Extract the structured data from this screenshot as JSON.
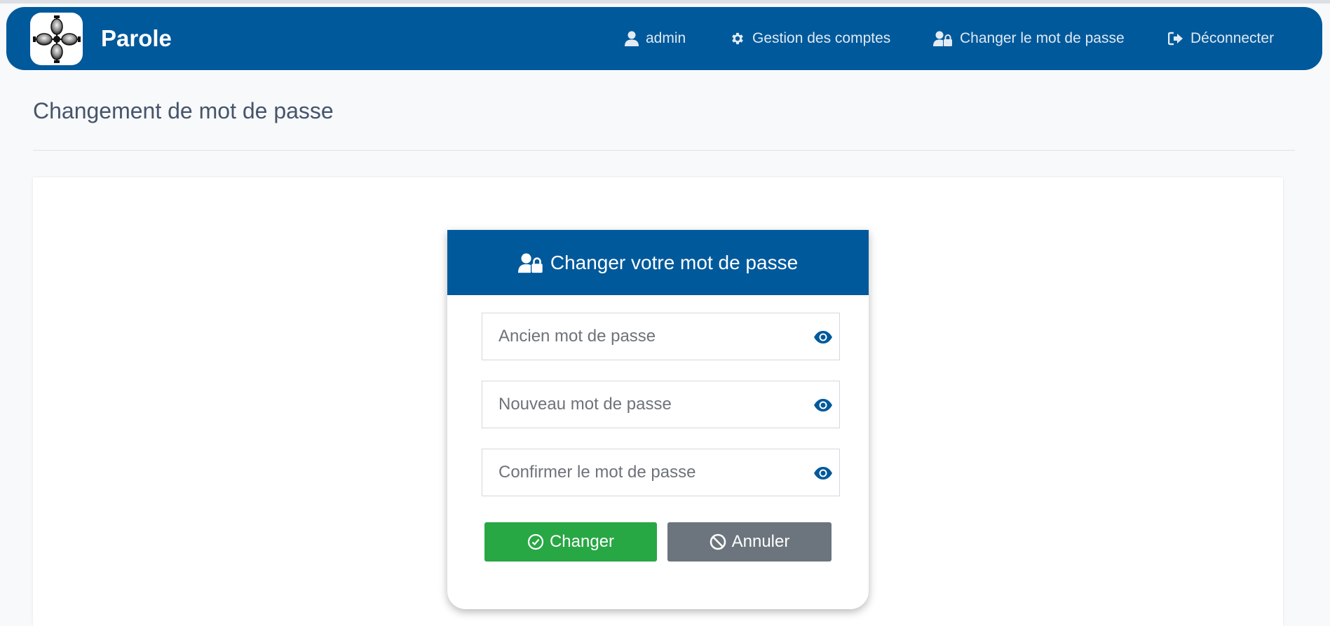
{
  "navbar": {
    "brand": "Parole",
    "items": [
      {
        "label": "admin",
        "icon": "user-icon"
      },
      {
        "label": "Gestion des comptes",
        "icon": "gear-icon"
      },
      {
        "label": "Changer le mot de passe",
        "icon": "user-lock-icon"
      },
      {
        "label": "Déconnecter",
        "icon": "sign-out-icon"
      }
    ]
  },
  "page": {
    "title": "Changement de mot de passe"
  },
  "form": {
    "header": "Changer votre mot de passe",
    "fields": [
      {
        "placeholder": "Ancien mot de passe",
        "value": ""
      },
      {
        "placeholder": "Nouveau mot de passe",
        "value": ""
      },
      {
        "placeholder": "Confirmer le mot de passe",
        "value": ""
      }
    ],
    "submit_label": "Changer",
    "cancel_label": "Annuler"
  },
  "colors": {
    "primary": "#00599b",
    "success": "#28a745",
    "secondary": "#6c757d"
  }
}
